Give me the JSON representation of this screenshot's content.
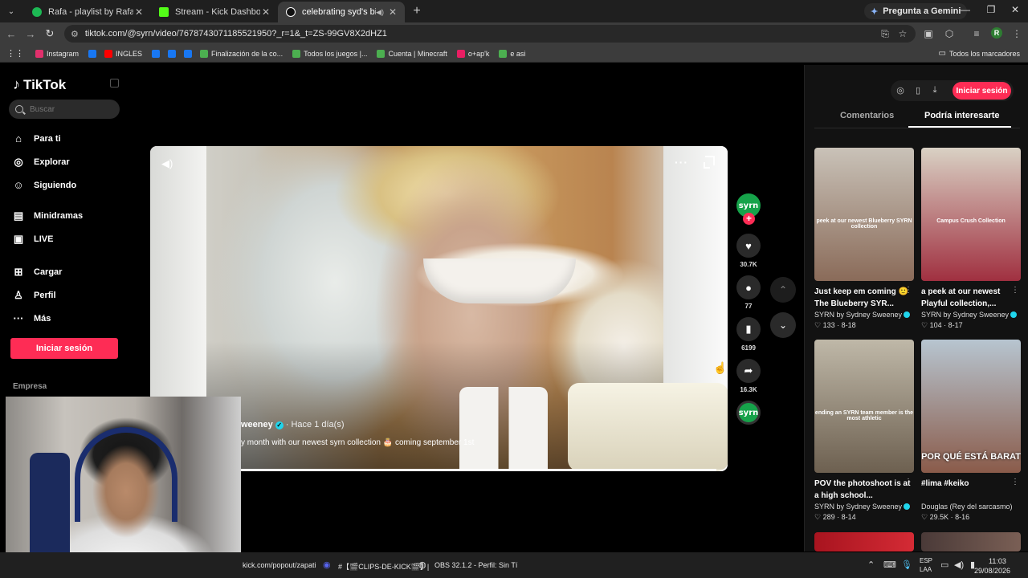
{
  "browser": {
    "tabs": [
      {
        "title": "Rafa - playlist by Rafael.xared |",
        "color": "#1db954"
      },
      {
        "title": "Stream - Kick Dashboard",
        "color": "#53fc18"
      },
      {
        "title": "celebrating syd's birthday",
        "color": "#ffffff"
      }
    ],
    "gemini_label": "Pregunta a Gemini",
    "url": "tiktok.com/@syrn/video/7678743071185521950?_r=1&_t=ZS-99GV8X2dHZ1",
    "profile_initial": "R",
    "bookmarks": [
      {
        "label": "Instagram",
        "color": "#e1306c"
      },
      {
        "label": "",
        "color": "#1877f2"
      },
      {
        "label": "INGLES",
        "color": "#ff0000"
      },
      {
        "label": "",
        "color": "#1877f2"
      },
      {
        "label": "",
        "color": "#1877f2"
      },
      {
        "label": "",
        "color": "#1877f2"
      },
      {
        "label": "Finalización de la co...",
        "color": "#4caf50"
      },
      {
        "label": "Todos los juegos |...",
        "color": "#4caf50"
      },
      {
        "label": "Cuenta | Minecraft",
        "color": "#4caf50"
      },
      {
        "label": "o+ap'k",
        "color": "#e91e63"
      },
      {
        "label": "e asi",
        "color": "#4caf50"
      }
    ],
    "all_bookmarks": "Todos los marcadores"
  },
  "tiktok": {
    "logo": "TikTok",
    "search_placeholder": "Buscar",
    "nav": [
      {
        "label": "Para ti",
        "icon": "home-icon"
      },
      {
        "label": "Explorar",
        "icon": "compass-icon"
      },
      {
        "label": "Siguiendo",
        "icon": "following-icon"
      },
      {
        "label": "Minidramas",
        "icon": "minidramas-icon"
      },
      {
        "label": "LIVE",
        "icon": "live-icon"
      },
      {
        "label": "Cargar",
        "icon": "upload-icon"
      },
      {
        "label": "Perfil",
        "icon": "profile-icon"
      },
      {
        "label": "Más",
        "icon": "more-icon"
      }
    ],
    "login_label": "Iniciar sesión",
    "company_label": "Empresa"
  },
  "video": {
    "author": "weeney",
    "time": "· Hace 1 día(s)",
    "caption": "y month with our newest syrn collection 🎂 coming september 1st",
    "progress": 0.98,
    "avatar_text": "syrn",
    "likes": "30.7K",
    "comments": "77",
    "saves": "6199",
    "shares": "16.3K"
  },
  "panel": {
    "login_label": "Iniciar sesión",
    "tabs": [
      "Comentarios",
      "Podría interesarte"
    ],
    "active_tab": 1,
    "cards": [
      {
        "title": "Just keep em coming 🙂 The Blueberry SYR...",
        "author": "SYRN by Sydney Sweeney",
        "verified": true,
        "likes": "♡ 133",
        "date": "8-18",
        "overlay": "peek at our newest Blueberry SYRN collection",
        "c1": "#c9c2b8",
        "c2": "#8a6b59"
      },
      {
        "title": "a peek at our newest Playful collection,...",
        "author": "SYRN by Sydney Sweeney",
        "verified": true,
        "likes": "♡ 104",
        "date": "8-17",
        "overlay": "Campus Crush Collection",
        "c1": "#d9d1c4",
        "c2": "#a03040"
      },
      {
        "title": "POV the photoshoot is at a high school...",
        "author": "SYRN by Sydney Sweeney",
        "verified": true,
        "likes": "♡ 289",
        "date": "8-14",
        "overlay": "ending an SYRN team member is the most athletic",
        "c1": "#bfb8a8",
        "c2": "#6d6050"
      },
      {
        "title": "#lima #keiko",
        "author": "Douglas (Rey del sarcasmo)",
        "verified": false,
        "likes": "♡ 29.5K",
        "date": "8-16",
        "overlay": "POR QUÉ ESTÁ BARAT",
        "c1": "#b7c5d0",
        "c2": "#8a5b4a"
      }
    ]
  },
  "taskbar": {
    "popout": "kick.com/popout/zapati",
    "discord": "#【🎬CLIPS-DE-KICK🎬】|",
    "obs": "OBS 32.1.2 - Perfil: Sin Tí",
    "lang1": "ESP",
    "lang2": "LAA",
    "time": "11:03",
    "date": "29/08/2026"
  }
}
